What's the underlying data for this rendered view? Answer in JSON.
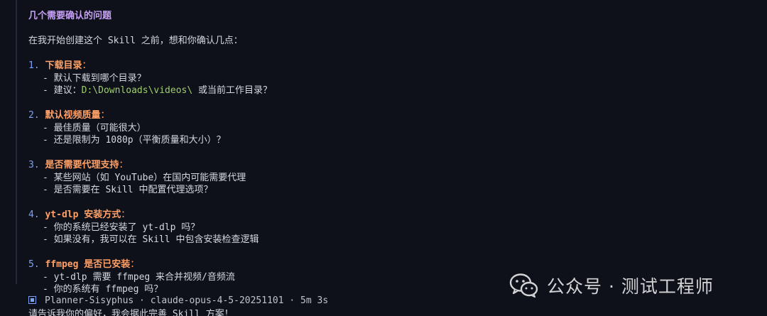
{
  "title": "几个需要确认的问题",
  "intro": "在我开始创建这个 Skill 之前，想和你确认几点：",
  "questions": [
    {
      "num": "1.",
      "heading": "下载目录",
      "items": [
        "- 默认下载到哪个目录？",
        {
          "prefix": "- 建议：",
          "path": "D:\\Downloads\\videos\\",
          "suffix": " 或当前工作目录？"
        }
      ]
    },
    {
      "num": "2.",
      "heading": "默认视频质量",
      "items": [
        "- 最佳质量（可能很大）",
        "- 还是限制为 1080p（平衡质量和大小）？"
      ]
    },
    {
      "num": "3.",
      "heading": "是否需要代理支持",
      "items": [
        "- 某些网站（如 YouTube）在国内可能需要代理",
        "- 是否需要在 Skill 中配置代理选项？"
      ]
    },
    {
      "num": "4.",
      "heading": "yt-dlp 安装方式",
      "items": [
        "- 你的系统已经安装了 yt-dlp 吗？",
        "- 如果没有，我可以在 Skill 中包含安装检查逻辑"
      ]
    },
    {
      "num": "5.",
      "heading": "ffmpeg 是否已安装",
      "items": [
        "- yt-dlp 需要 ffmpeg 来合并视频/音频流",
        "- 你的系统有 ffmpeg 吗？"
      ]
    }
  ],
  "closing": "请告诉我你的偏好，我会据此完善 Skill 方案！",
  "colon": "：",
  "footer": {
    "agent": "Planner-Sisyphus",
    "model": "claude-opus-4-5-20251101",
    "duration": "5m 3s",
    "separator": " · "
  },
  "watermark": {
    "text": "公众号 · 测试工程师",
    "icon": "wechat-icon"
  },
  "colors": {
    "background": "#0f111a",
    "title": "#c6a0f6",
    "heading": "#ffa066",
    "number": "#7aa2f7",
    "path": "#9ece6a",
    "text": "#d6d8e0"
  }
}
